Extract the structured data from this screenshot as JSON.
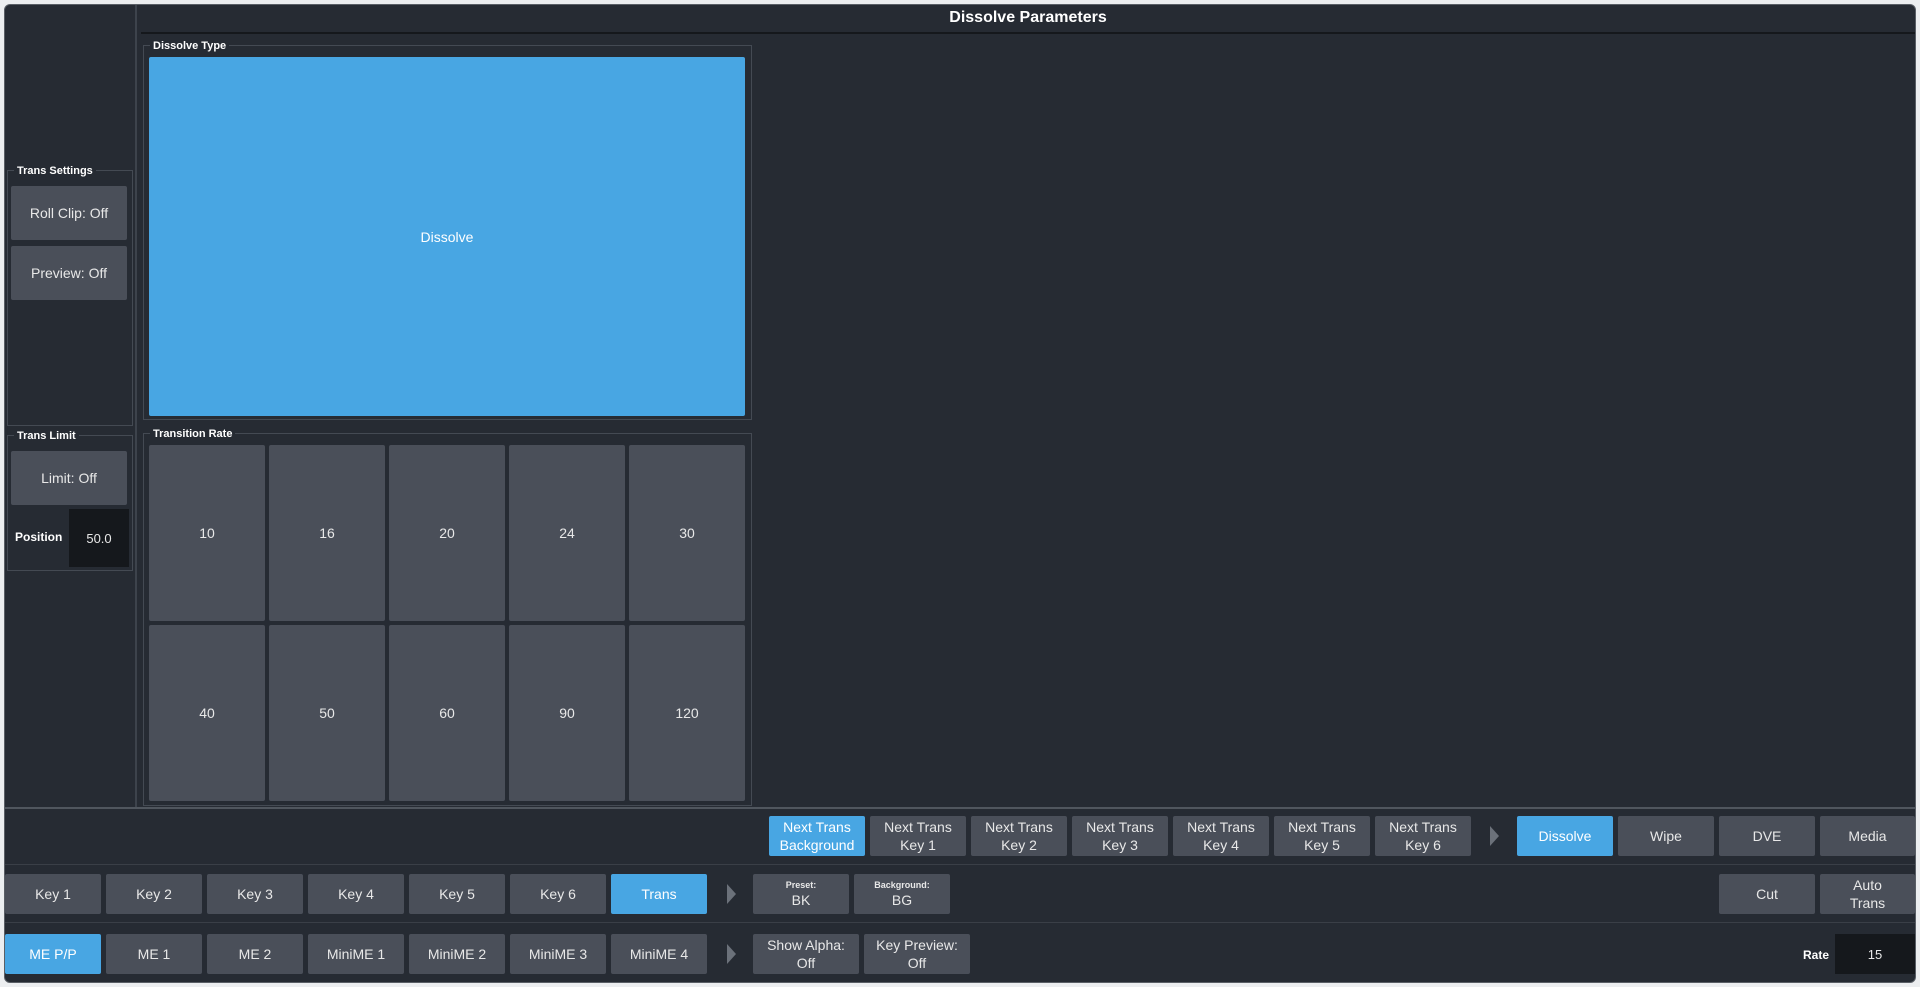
{
  "title": "Dissolve Parameters",
  "trans_settings": {
    "label": "Trans Settings",
    "roll_clip": "Roll Clip: Off",
    "preview": "Preview: Off"
  },
  "trans_limit": {
    "label": "Trans Limit",
    "limit": "Limit: Off",
    "position_label": "Position",
    "position_value": "50.0"
  },
  "dissolve_type": {
    "label": "Dissolve Type",
    "option": "Dissolve"
  },
  "transition_rate": {
    "label": "Transition Rate",
    "values": [
      "10",
      "16",
      "20",
      "24",
      "30",
      "40",
      "50",
      "60",
      "90",
      "120"
    ]
  },
  "next_trans": [
    {
      "line1": "Next Trans",
      "line2": "Background",
      "active": true
    },
    {
      "line1": "Next Trans",
      "line2": "Key 1",
      "active": false
    },
    {
      "line1": "Next Trans",
      "line2": "Key 2",
      "active": false
    },
    {
      "line1": "Next Trans",
      "line2": "Key 3",
      "active": false
    },
    {
      "line1": "Next Trans",
      "line2": "Key 4",
      "active": false
    },
    {
      "line1": "Next Trans",
      "line2": "Key 5",
      "active": false
    },
    {
      "line1": "Next Trans",
      "line2": "Key 6",
      "active": false
    }
  ],
  "trans_types": [
    "Dissolve",
    "Wipe",
    "DVE",
    "Media"
  ],
  "keys_row": [
    "Key 1",
    "Key 2",
    "Key 3",
    "Key 4",
    "Key 5",
    "Key 6",
    "Trans"
  ],
  "preset": {
    "label": "Preset:",
    "value": "BK"
  },
  "background": {
    "label": "Background:",
    "value": "BG"
  },
  "cut": "Cut",
  "auto_trans": {
    "line1": "Auto",
    "line2": "Trans"
  },
  "me_row": [
    "ME P/P",
    "ME 1",
    "ME 2",
    "MiniME 1",
    "MiniME 2",
    "MiniME 3",
    "MiniME 4"
  ],
  "show_alpha": {
    "line1": "Show Alpha:",
    "line2": "Off"
  },
  "key_preview": {
    "line1": "Key Preview:",
    "line2": "Off"
  },
  "rate": {
    "label": "Rate",
    "value": "15"
  },
  "colors": {
    "accent": "#48a6e3",
    "button": "#4a4f59",
    "background": "#262b33"
  }
}
